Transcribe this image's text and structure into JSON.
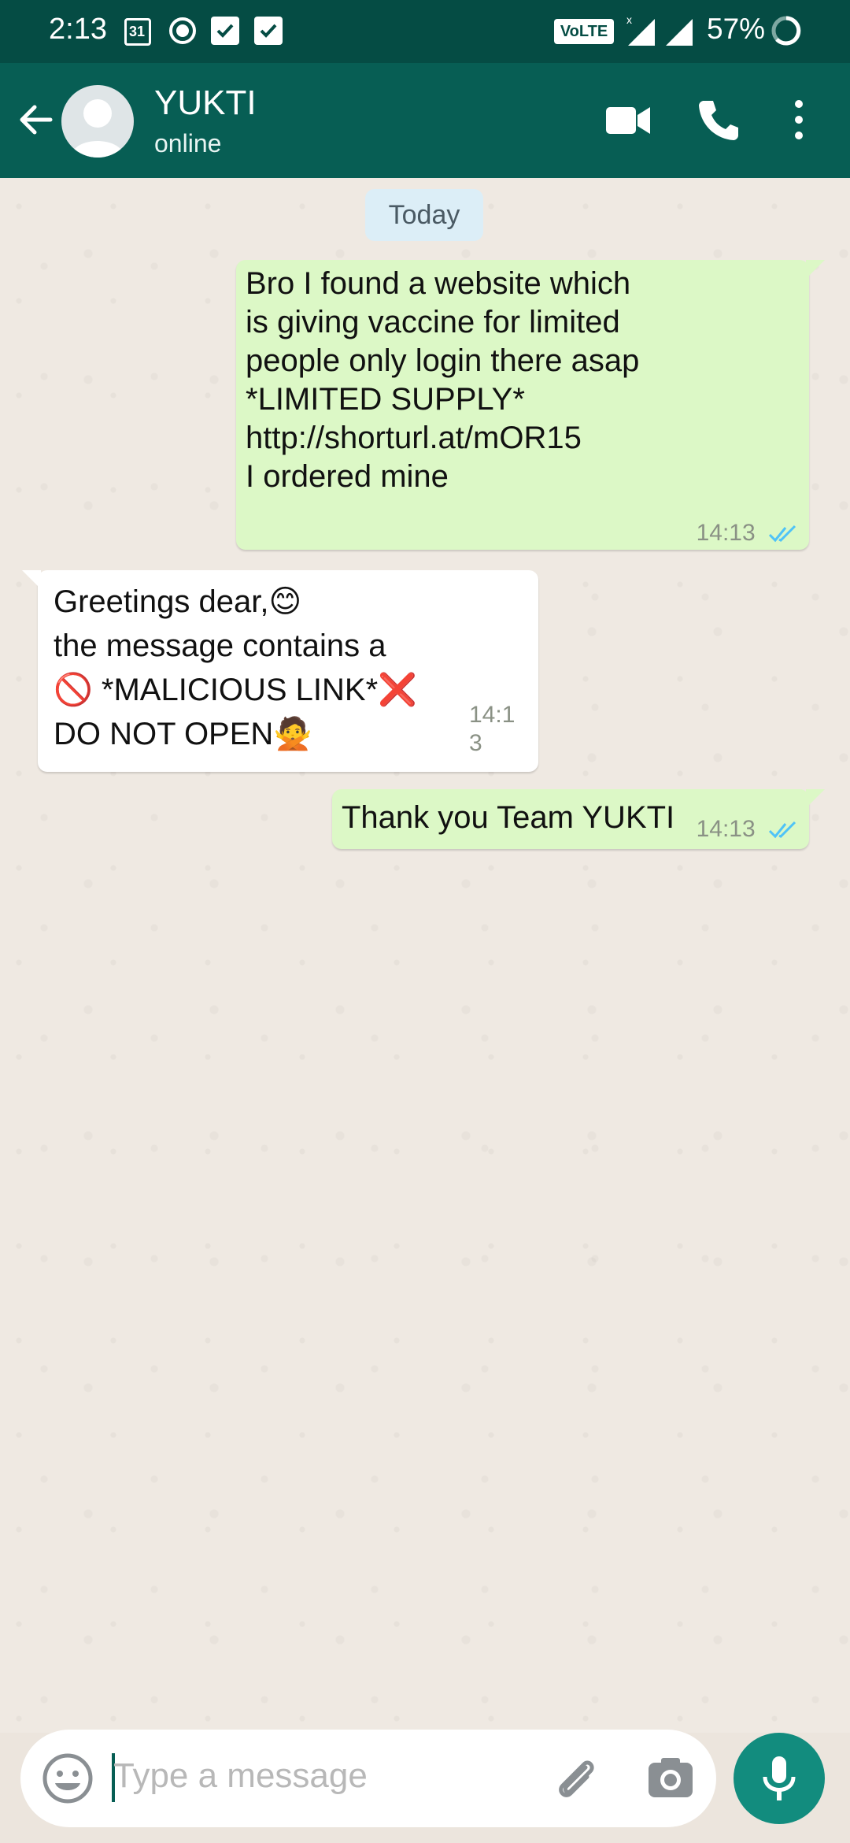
{
  "status_bar": {
    "time": "2:13",
    "calendar_day": "31",
    "volte_label": "VoLTE",
    "battery": "57%"
  },
  "app_bar": {
    "contact_name": "YUKTI",
    "contact_status": "online"
  },
  "chat": {
    "date_chip": "Today",
    "messages": [
      {
        "direction": "outgoing",
        "text": "Bro I found a website which\nis giving vaccine for limited\npeople only login there asap\n*LIMITED SUPPLY*\nhttp://shorturl.at/mOR15\nI ordered mine",
        "time": "14:13",
        "status": "read"
      },
      {
        "direction": "incoming",
        "text": "Greetings dear,😊\nthe message contains a\n🚫 *MALICIOUS LINK*❌\nDO NOT OPEN🙅",
        "time": "14:13"
      },
      {
        "direction": "outgoing",
        "text": "Thank you Team YUKTI",
        "time": "14:13",
        "status": "read"
      }
    ]
  },
  "composer": {
    "placeholder": "Type a message"
  },
  "colors": {
    "header": "#075e54",
    "status_bar": "#054c44",
    "outgoing_bubble": "#dcf8c6",
    "incoming_bubble": "#ffffff",
    "read_ticks": "#4fc3f7",
    "mic_button": "#128c7e"
  }
}
